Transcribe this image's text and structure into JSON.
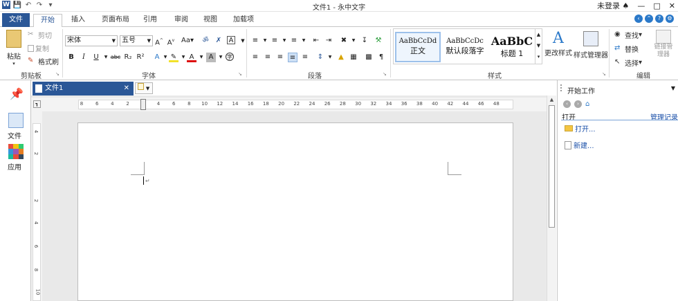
{
  "app": {
    "title": "文件1 - 永中文字",
    "login": "未登录"
  },
  "tabs": [
    "文件",
    "开始",
    "插入",
    "页面布局",
    "引用",
    "审阅",
    "视图",
    "加载项"
  ],
  "ribbon": {
    "clipboard": {
      "paste": "粘贴",
      "cut": "剪切",
      "copy": "复制",
      "format_painter": "格式刷",
      "label": "剪贴板"
    },
    "font": {
      "name": "宋体",
      "size": "五号",
      "case": "Aa",
      "label": "字体",
      "bold": "B",
      "italic": "I",
      "underline": "U",
      "strike": "abc",
      "sub": "R₂",
      "sup": "R²"
    },
    "paragraph": {
      "label": "段落"
    },
    "styles": {
      "items": [
        {
          "sample": "AaBbCcDd",
          "name": "正文"
        },
        {
          "sample": "AaBbCcDc",
          "name": "默认段落字"
        },
        {
          "sample": "AaBbC",
          "name": "标题 1"
        }
      ],
      "change": "更改样式",
      "manager": "样式管理器",
      "label": "样式"
    },
    "editing": {
      "find": "查找",
      "replace": "替换",
      "select": "选择",
      "link_manager": "链接管理器",
      "label": "编辑"
    }
  },
  "leftbar": {
    "file": "文件",
    "apps": "应用"
  },
  "doc": {
    "tab": "文件1"
  },
  "ruler": {
    "h_ticks": [
      "8",
      "6",
      "4",
      "2",
      "2",
      "4",
      "6",
      "8",
      "10",
      "12",
      "14",
      "16",
      "18",
      "20",
      "22",
      "24",
      "26",
      "28",
      "30",
      "32",
      "34",
      "36",
      "38",
      "40",
      "42",
      "44",
      "46",
      "48"
    ],
    "v_ticks": [
      "4",
      "2",
      "2",
      "4",
      "6",
      "8",
      "10"
    ]
  },
  "taskpane": {
    "title": "开始工作",
    "open_heading": "打开",
    "manage": "管理记录",
    "open": "打开...",
    "new": "新建..."
  }
}
